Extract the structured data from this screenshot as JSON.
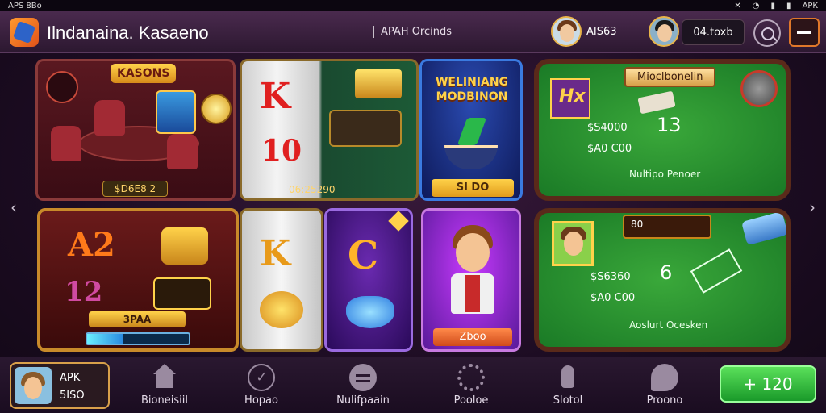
{
  "status_bar": {
    "left_text": "APS 8Bo",
    "right_text": "APK"
  },
  "header": {
    "app_title": "Ilndanaina. Kasaeno",
    "center_label": "APAH Orcinds",
    "player1_value": "AIS63",
    "balance": "04.toxb"
  },
  "tiles": {
    "room": {
      "tag": "KASONS",
      "footer_value": "$D6E8 2"
    },
    "reel1": {
      "symbol_top": "K",
      "symbol_bottom": "10",
      "value": "06:25290"
    },
    "welcome": {
      "title": "WELINIANG MODBINON",
      "button": "SI DO"
    },
    "table1": {
      "banner": "Mioclbonelin",
      "card_text": "Hx",
      "value1": "$S4000",
      "value2": "$A0 C00",
      "number": "13",
      "subtitle": "Nultipo Penoer"
    },
    "slot2": {
      "symbol": "A2",
      "symbol2": "12",
      "bar_label": "3PAA",
      "meter_fill": 0.35
    },
    "reel2": {
      "symbol": "K"
    },
    "gem": {
      "symbol": "C"
    },
    "hero": {
      "button": "Zboo"
    },
    "table2": {
      "banner": "80",
      "value1": "$S6360",
      "value2": "$A0 C00",
      "number": "6",
      "subtitle": "Aoslurt Ocesken"
    }
  },
  "nav_arrows": {
    "left": "‹",
    "right": "›"
  },
  "bottom_bar": {
    "profile_line1": "APK",
    "profile_line2": "5ISO",
    "items": [
      {
        "label": "Bioneisiil",
        "icon": "home-icon"
      },
      {
        "label": "Hopao",
        "icon": "check-circle-icon"
      },
      {
        "label": "Nulifpaain",
        "icon": "chat-icon"
      },
      {
        "label": "Pooloe",
        "icon": "gear-icon"
      },
      {
        "label": "Slotol",
        "icon": "rocket-icon"
      },
      {
        "label": "Proono",
        "icon": "promo-icon"
      }
    ],
    "cta_label": "+ 120"
  }
}
